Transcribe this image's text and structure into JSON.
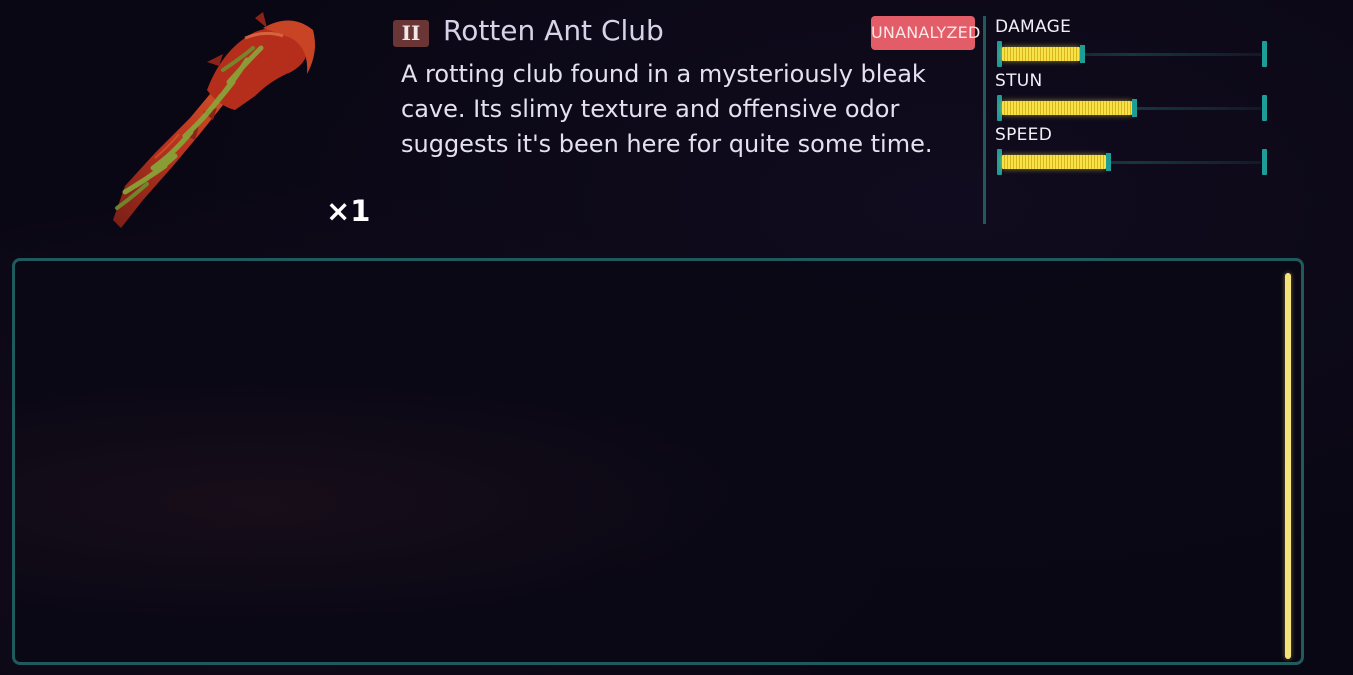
{
  "item": {
    "name": "Rotten Ant Club",
    "tier": "II",
    "tier_color": "#6a3535",
    "status": "UNANALYZED",
    "status_color": "#e25d68",
    "quantity": "×1",
    "description": "A rotting club found in a mysteriously bleak cave. Its slimy texture and offensive odor suggests it's been here for quite some time.",
    "icon": "rotten-ant-club-icon"
  },
  "stats": [
    {
      "label": "DAMAGE",
      "value": 0.3
    },
    {
      "label": "STUN",
      "value": 0.5
    },
    {
      "label": "SPEED",
      "value": 0.4
    }
  ],
  "colors": {
    "accent_teal": "#1f5a5d",
    "bar_fill": "#f8e24a",
    "scrollbar": "#f5e27a"
  }
}
